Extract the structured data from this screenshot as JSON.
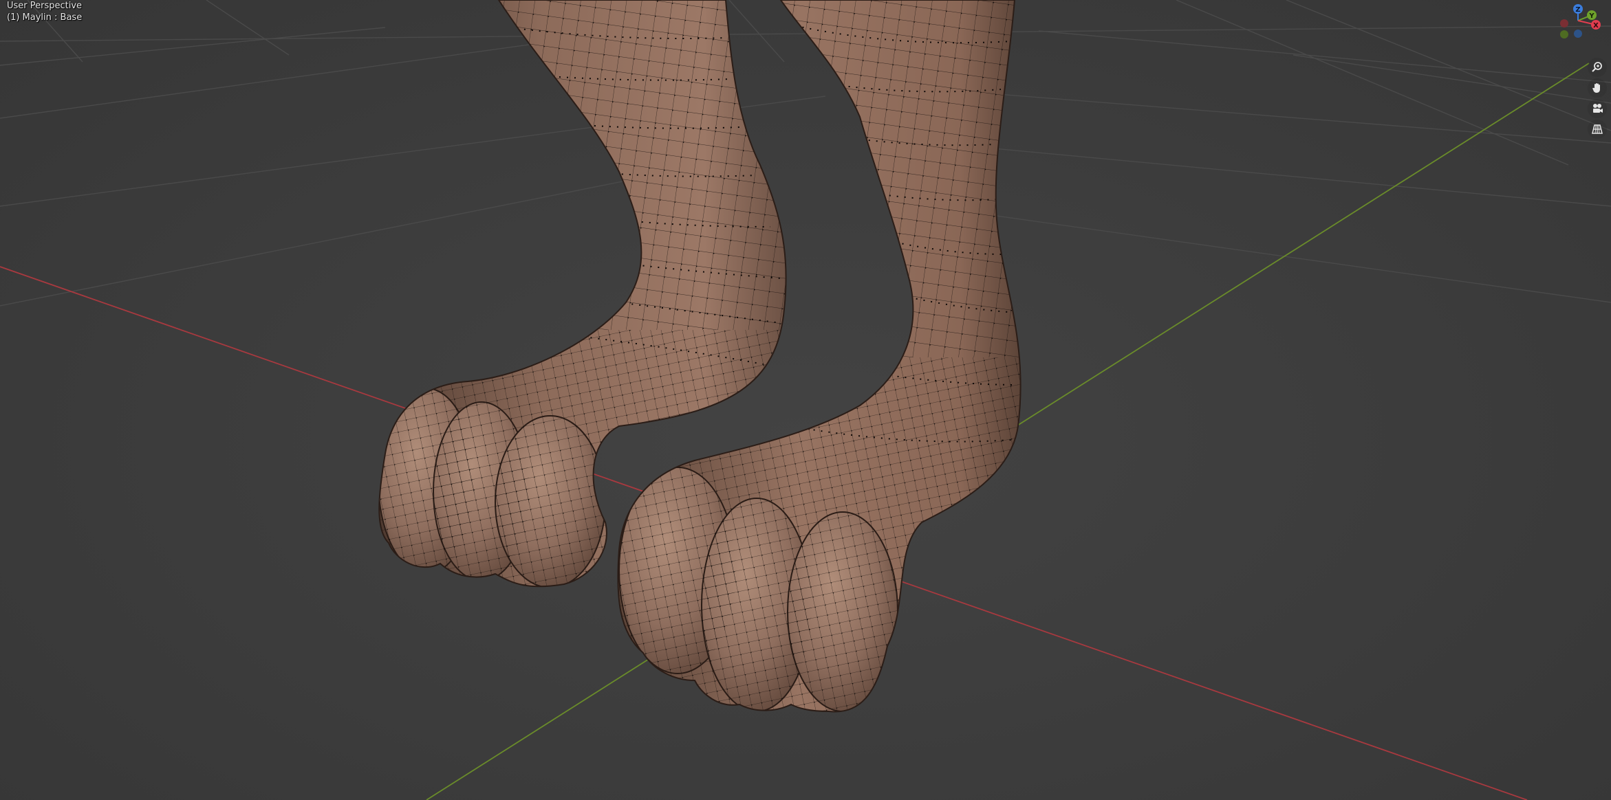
{
  "viewport": {
    "view_name": "User Perspective",
    "object_info": "(1) Maylin : Base"
  },
  "gizmo": {
    "axes": [
      {
        "name": "Z",
        "color": "#3b7ddd"
      },
      {
        "name": "Y",
        "color": "#6fa32b"
      },
      {
        "name": "X",
        "color": "#e23d4f"
      }
    ]
  },
  "nav_tools": [
    {
      "icon": "zoom-icon"
    },
    {
      "icon": "hand-pan-icon"
    },
    {
      "icon": "camera-view-icon"
    },
    {
      "icon": "grid-ortho-icon"
    }
  ],
  "colors": {
    "background": "#3d3d3d",
    "grid_line": "#4a4a4a",
    "x_axis": "#a8393f",
    "y_axis": "#6a8c2a",
    "mesh_skin": "#8e6f5e",
    "wire": "#111111"
  }
}
